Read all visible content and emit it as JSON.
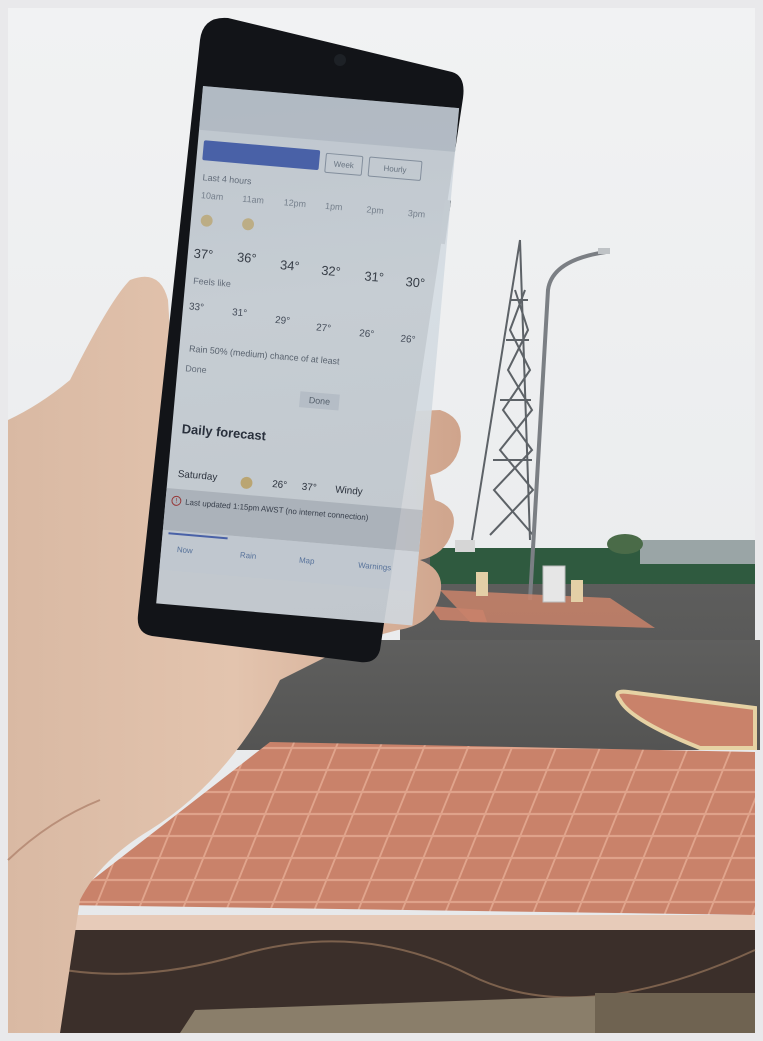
{
  "weather_app": {
    "tabs": {
      "primary": "",
      "second": "Week",
      "third": "Hourly"
    },
    "section_label": "Last 4 hours",
    "hours": [
      "10am",
      "11am",
      "12pm",
      "1pm",
      "2pm",
      "3pm"
    ],
    "temps": [
      "37°",
      "36°",
      "34°",
      "32°",
      "31°",
      "30°"
    ],
    "feels_label": "Feels like",
    "feels": [
      "33°",
      "31°",
      "29°",
      "27°",
      "26°",
      "26°"
    ],
    "rain_text": "Rain 50% (medium) chance of at least",
    "done_label": "Done",
    "daily_title": "Daily forecast",
    "daily_row": {
      "day": "Saturday",
      "min": "26°",
      "max": "37°",
      "text": "Windy"
    },
    "banner_text": "Last updated 1:15pm AWST (no internet connection)",
    "nav": [
      "Now",
      "Rain",
      "Map",
      "Warnings"
    ]
  }
}
